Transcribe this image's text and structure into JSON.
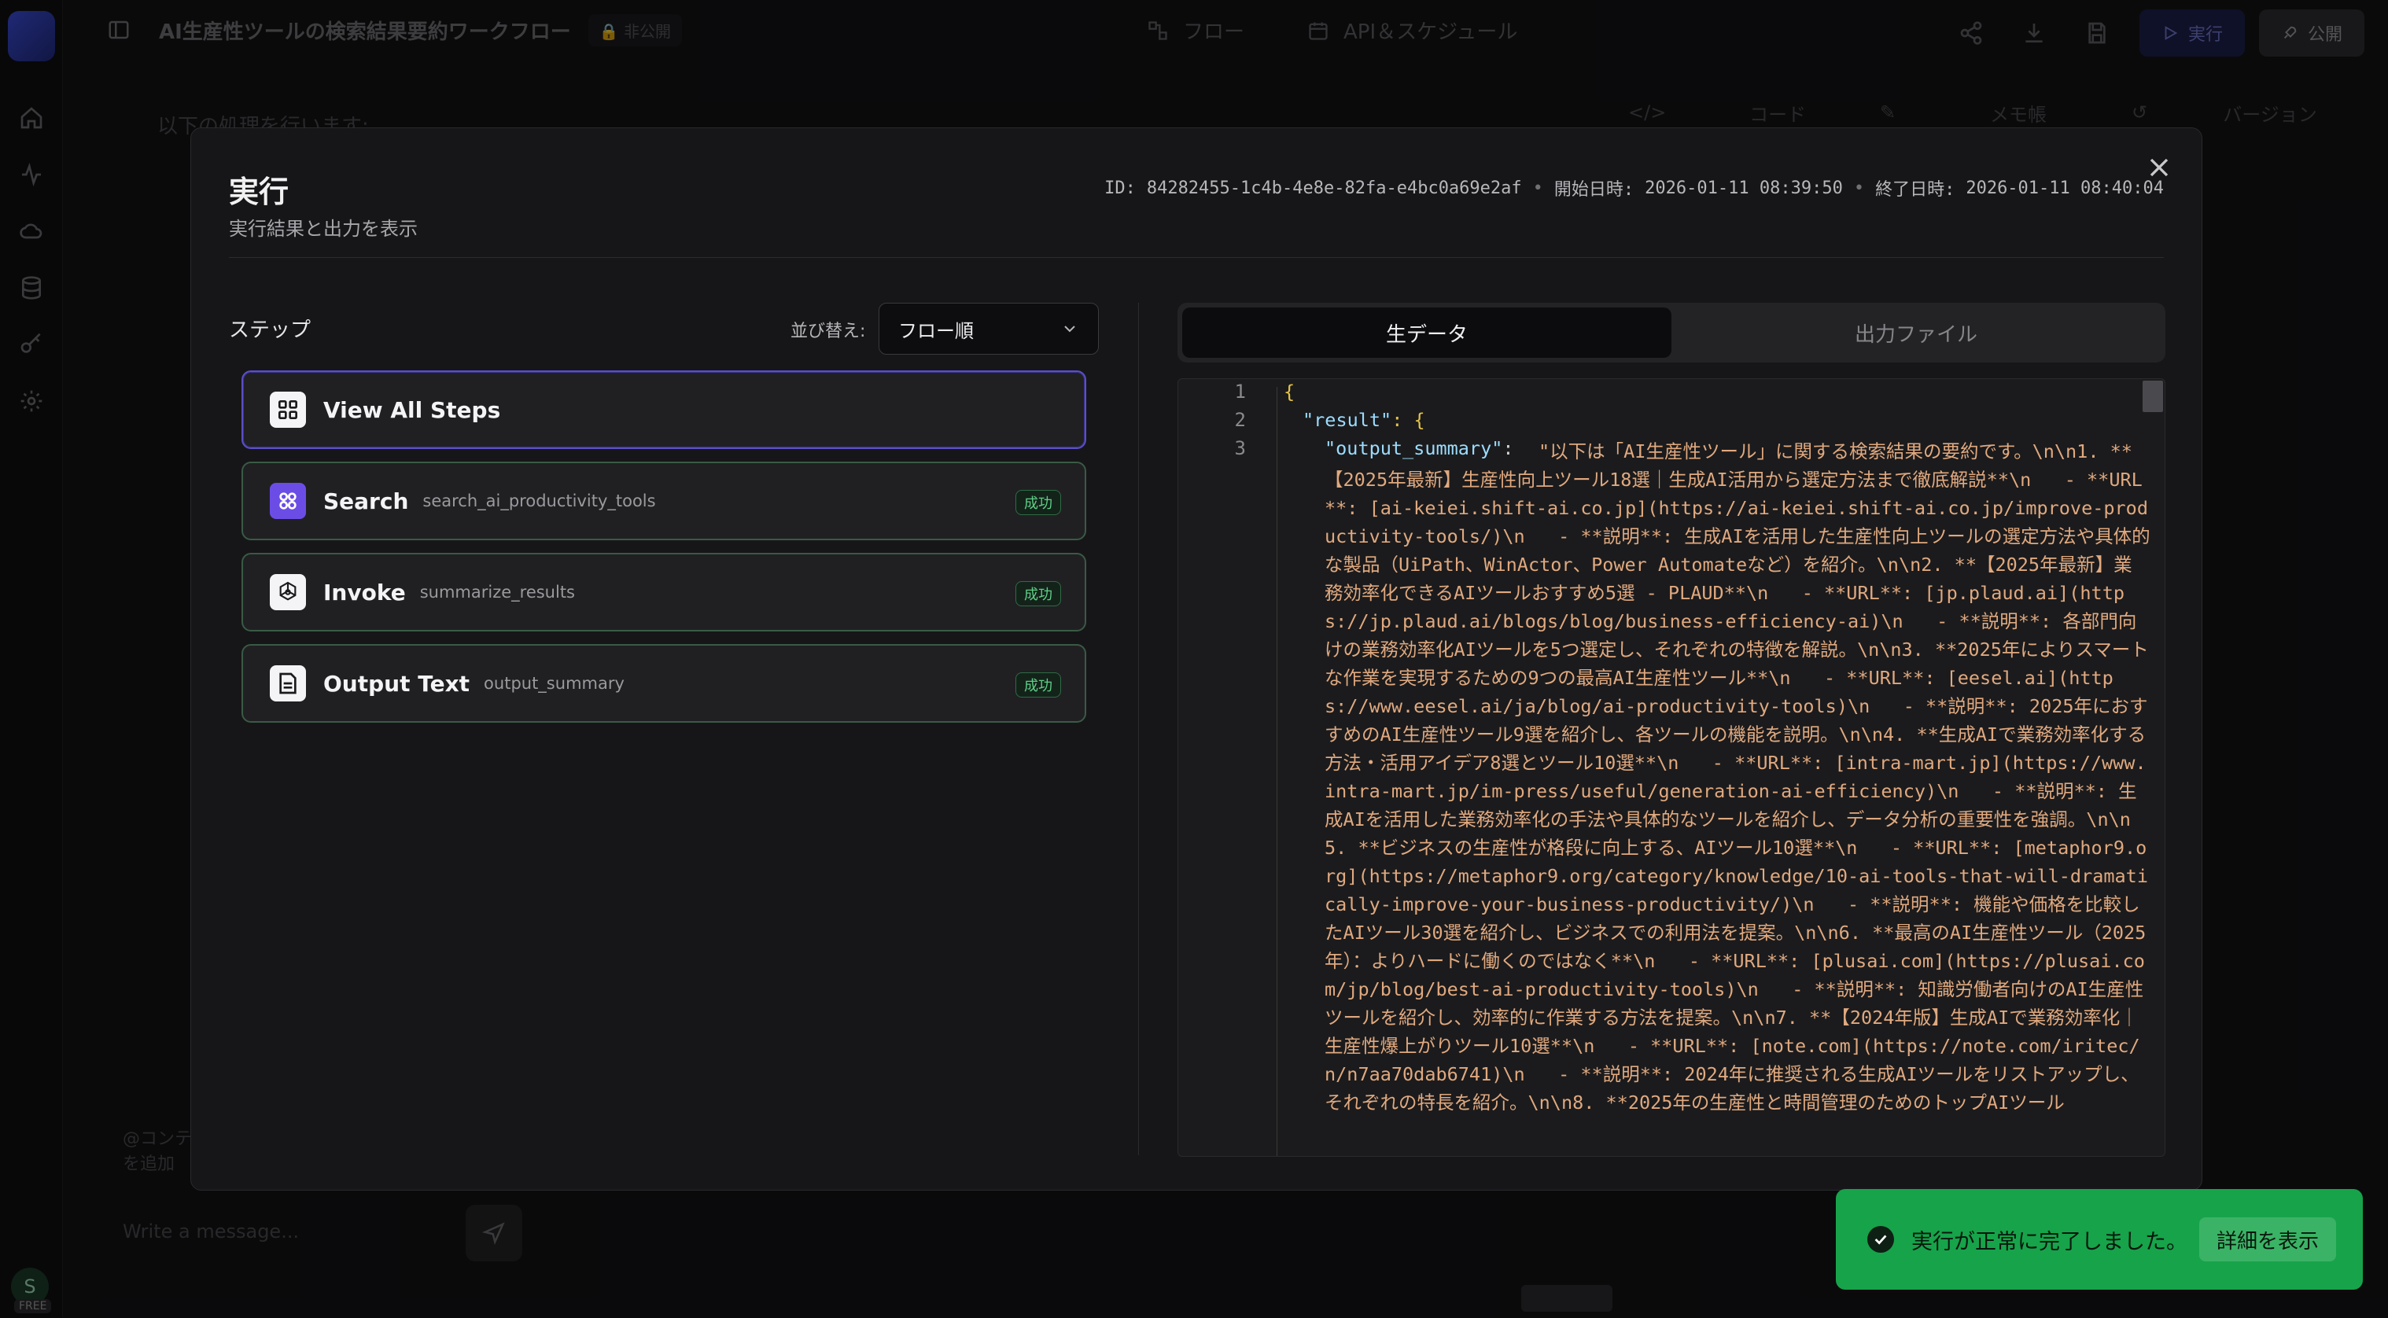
{
  "topbar": {
    "title": "AI生産性ツールの検索結果要約ワークフロー",
    "private_badge": "非公開",
    "tab_flow": "フロー",
    "tab_api": "API＆スケジュール",
    "run_label": "実行",
    "publish_label": "公開"
  },
  "background": {
    "intro": "以下の処理を行います:",
    "chat_placeholder": "Write a message...",
    "panel_tab_code": "コード",
    "panel_tab_memo": "メモ帳",
    "panel_tab_version": "バージョン",
    "mention_hint_1": "@コンテ",
    "mention_hint_2": "を追加",
    "avatar_letter": "S",
    "plan_badge": "FREE"
  },
  "modal": {
    "title": "実行",
    "subtitle": "実行結果と出力を表示",
    "meta": {
      "id_label": "ID:",
      "id_value": "84282455-1c4b-4e8e-82fa-e4bc0a69e2af",
      "start_label": "開始日時:",
      "start_value": "2026-01-11 08:39:50",
      "end_label": "終了日時:",
      "end_value": "2026-01-11 08:40:04"
    },
    "steps_header": "ステップ",
    "sort_label": "並び替え:",
    "sort_value": "フロー順",
    "steps": [
      {
        "name": "View All Steps",
        "id": "",
        "badge": ""
      },
      {
        "name": "Search",
        "id": "search_ai_productivity_tools",
        "badge": "成功"
      },
      {
        "name": "Invoke",
        "id": "summarize_results",
        "badge": "成功"
      },
      {
        "name": "Output Text",
        "id": "output_summary",
        "badge": "成功"
      }
    ],
    "tabs": {
      "raw": "生データ",
      "files": "出力ファイル"
    },
    "code": {
      "line_numbers": [
        "1",
        "2",
        "3"
      ],
      "line1": "{",
      "line2_key": "\"result\"",
      "line2_rest": ": {",
      "line3_key": "\"output_summary\"",
      "line3_sep": ": ",
      "line3_value": "\"以下は「AI生産性ツール」に関する検索結果の要約です。\\n\\n1. **【2025年最新】生産性向上ツール18選｜生成AI活用から選定方法まで徹底解説**\\n   - **URL**: [ai-keiei.shift-ai.co.jp](https://ai-keiei.shift-ai.co.jp/improve-productivity-tools/)\\n   - **説明**: 生成AIを活用した生産性向上ツールの選定方法や具体的な製品（UiPath、WinActor、Power Automateなど）を紹介。\\n\\n2. **【2025年最新】業務効率化できるAIツールおすすめ5選 - PLAUD**\\n   - **URL**: [jp.plaud.ai](https://jp.plaud.ai/blogs/blog/business-efficiency-ai)\\n   - **説明**: 各部門向けの業務効率化AIツールを5つ選定し、それぞれの特徴を解説。\\n\\n3. **2025年によりスマートな作業を実現するための9つの最高AI生産性ツール**\\n   - **URL**: [eesel.ai](https://www.eesel.ai/ja/blog/ai-productivity-tools)\\n   - **説明**: 2025年におすすめのAI生産性ツール9選を紹介し、各ツールの機能を説明。\\n\\n4. **生成AIで業務効率化する方法・活用アイデア8選とツール10選**\\n   - **URL**: [intra-mart.jp](https://www.intra-mart.jp/im-press/useful/generation-ai-efficiency)\\n   - **説明**: 生成AIを活用した業務効率化の手法や具体的なツールを紹介し、データ分析の重要性を強調。\\n\\n5. **ビジネスの生産性が格段に向上する、AIツール10選**\\n   - **URL**: [metaphor9.org](https://metaphor9.org/category/knowledge/10-ai-tools-that-will-dramatically-improve-your-business-productivity/)\\n   - **説明**: 機能や価格を比較したAIツール30選を紹介し、ビジネスでの利用法を提案。\\n\\n6. **最高のAI生産性ツール（2025年）：よりハードに働くのではなく**\\n   - **URL**: [plusai.com](https://plusai.com/jp/blog/best-ai-productivity-tools)\\n   - **説明**: 知識労働者向けのAI生産性ツールを紹介し、効率的に作業する方法を提案。\\n\\n7. **【2024年版】生成AIで業務効率化｜生産性爆上がりツール10選**\\n   - **URL**: [note.com](https://note.com/iritec/n/n7aa70dab6741)\\n   - **説明**: 2024年に推奨される生成AIツールをリストアップし、それぞれの特長を紹介。\\n\\n8. **2025年の生産性と時間管理のためのトップAIツール"
    }
  },
  "toast": {
    "message": "実行が正常に完了しました。",
    "button": "詳細を表示"
  },
  "colors": {
    "accent": "#5a4fc7",
    "success": "#17a34a",
    "success_badge": "#5fcf85"
  }
}
